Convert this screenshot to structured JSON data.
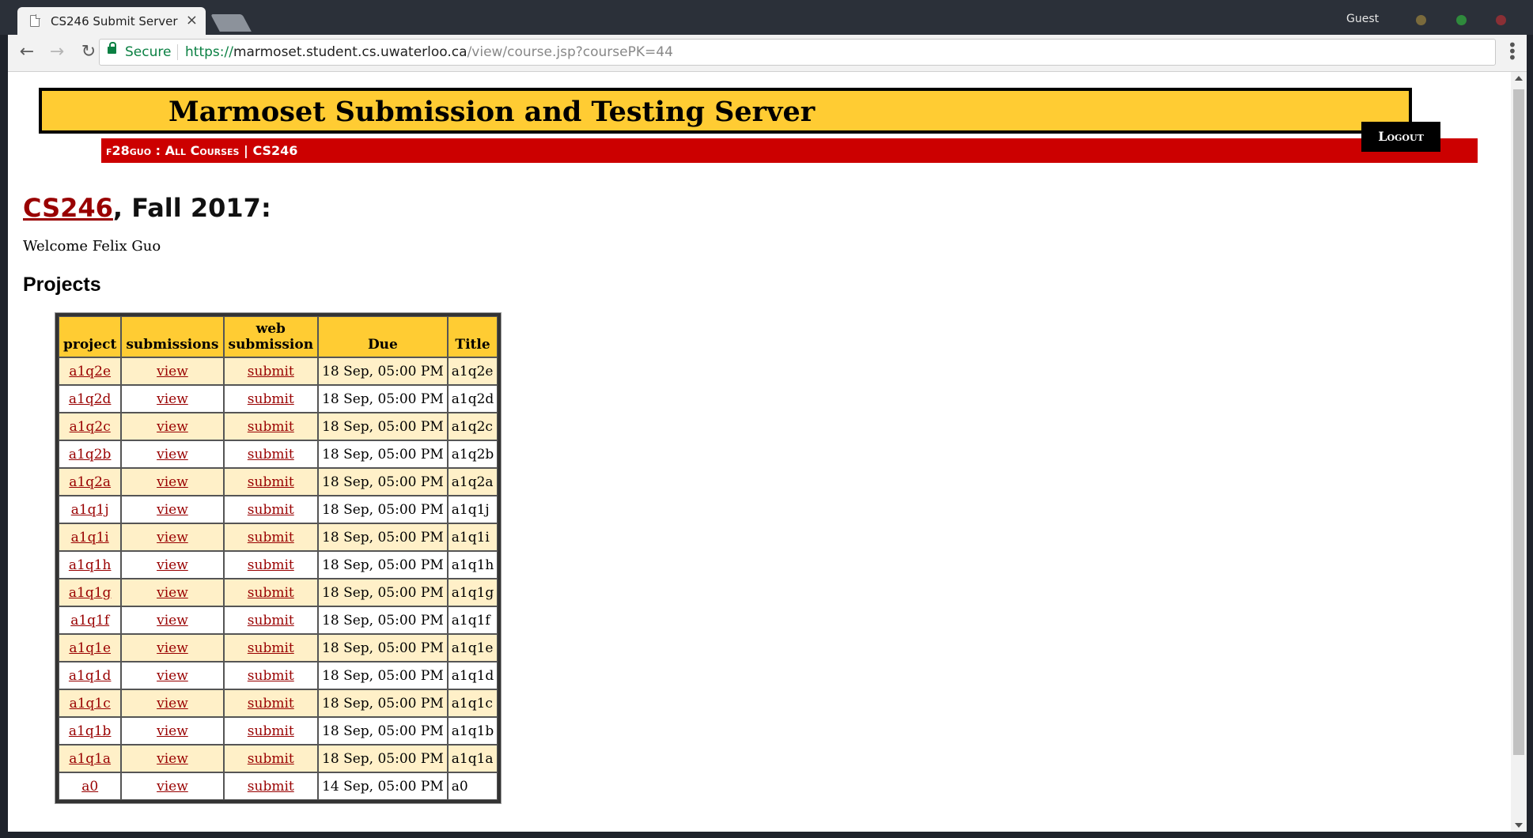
{
  "browser": {
    "tab_title": "CS246 Submit Server",
    "tab_close": "×",
    "profile": "Guest",
    "security_label": "Secure",
    "url_scheme": "https://",
    "url_host": "marmoset.student.cs.uwaterloo.ca",
    "url_path": "/view/course.jsp?coursePK=44"
  },
  "header": {
    "title": "Marmoset Submission and Testing Server",
    "breadcrumb_user": "f28guo",
    "breadcrumb_sep1": " : ",
    "breadcrumb_courses": "All Courses",
    "breadcrumb_sep2": " | ",
    "breadcrumb_course": "CS246",
    "logout_label": "Logout"
  },
  "page": {
    "course_link": "CS246",
    "term_suffix": ", Fall 2017:",
    "welcome": "Welcome Felix Guo",
    "projects_heading": "Projects"
  },
  "table": {
    "headers": [
      "project",
      "submissions",
      "web submission",
      "Due",
      "Title"
    ],
    "rows": [
      {
        "project": "a1q2e",
        "submissions": "view",
        "web": "submit",
        "due": "18 Sep, 05:00 PM",
        "title": "a1q2e"
      },
      {
        "project": "a1q2d",
        "submissions": "view",
        "web": "submit",
        "due": "18 Sep, 05:00 PM",
        "title": "a1q2d"
      },
      {
        "project": "a1q2c",
        "submissions": "view",
        "web": "submit",
        "due": "18 Sep, 05:00 PM",
        "title": "a1q2c"
      },
      {
        "project": "a1q2b",
        "submissions": "view",
        "web": "submit",
        "due": "18 Sep, 05:00 PM",
        "title": "a1q2b"
      },
      {
        "project": "a1q2a",
        "submissions": "view",
        "web": "submit",
        "due": "18 Sep, 05:00 PM",
        "title": "a1q2a"
      },
      {
        "project": "a1q1j",
        "submissions": "view",
        "web": "submit",
        "due": "18 Sep, 05:00 PM",
        "title": "a1q1j"
      },
      {
        "project": "a1q1i",
        "submissions": "view",
        "web": "submit",
        "due": "18 Sep, 05:00 PM",
        "title": "a1q1i"
      },
      {
        "project": "a1q1h",
        "submissions": "view",
        "web": "submit",
        "due": "18 Sep, 05:00 PM",
        "title": "a1q1h"
      },
      {
        "project": "a1q1g",
        "submissions": "view",
        "web": "submit",
        "due": "18 Sep, 05:00 PM",
        "title": "a1q1g"
      },
      {
        "project": "a1q1f",
        "submissions": "view",
        "web": "submit",
        "due": "18 Sep, 05:00 PM",
        "title": "a1q1f"
      },
      {
        "project": "a1q1e",
        "submissions": "view",
        "web": "submit",
        "due": "18 Sep, 05:00 PM",
        "title": "a1q1e"
      },
      {
        "project": "a1q1d",
        "submissions": "view",
        "web": "submit",
        "due": "18 Sep, 05:00 PM",
        "title": "a1q1d"
      },
      {
        "project": "a1q1c",
        "submissions": "view",
        "web": "submit",
        "due": "18 Sep, 05:00 PM",
        "title": "a1q1c"
      },
      {
        "project": "a1q1b",
        "submissions": "view",
        "web": "submit",
        "due": "18 Sep, 05:00 PM",
        "title": "a1q1b"
      },
      {
        "project": "a1q1a",
        "submissions": "view",
        "web": "submit",
        "due": "18 Sep, 05:00 PM",
        "title": "a1q1a"
      },
      {
        "project": "a0",
        "submissions": "view",
        "web": "submit",
        "due": "14 Sep, 05:00 PM",
        "title": "a0"
      }
    ]
  },
  "icons": {
    "tab": "document-icon",
    "close": "close-icon",
    "back": "back-arrow-icon",
    "forward": "forward-arrow-icon",
    "reload": "reload-icon",
    "lock": "lock-icon",
    "menu": "kebab-menu-icon"
  },
  "colors": {
    "banner": "#ffcc33",
    "breadcrumb_bar": "#cc0000",
    "link": "#990000",
    "row_alt": "#fff0c8",
    "secure": "#0b8043"
  }
}
